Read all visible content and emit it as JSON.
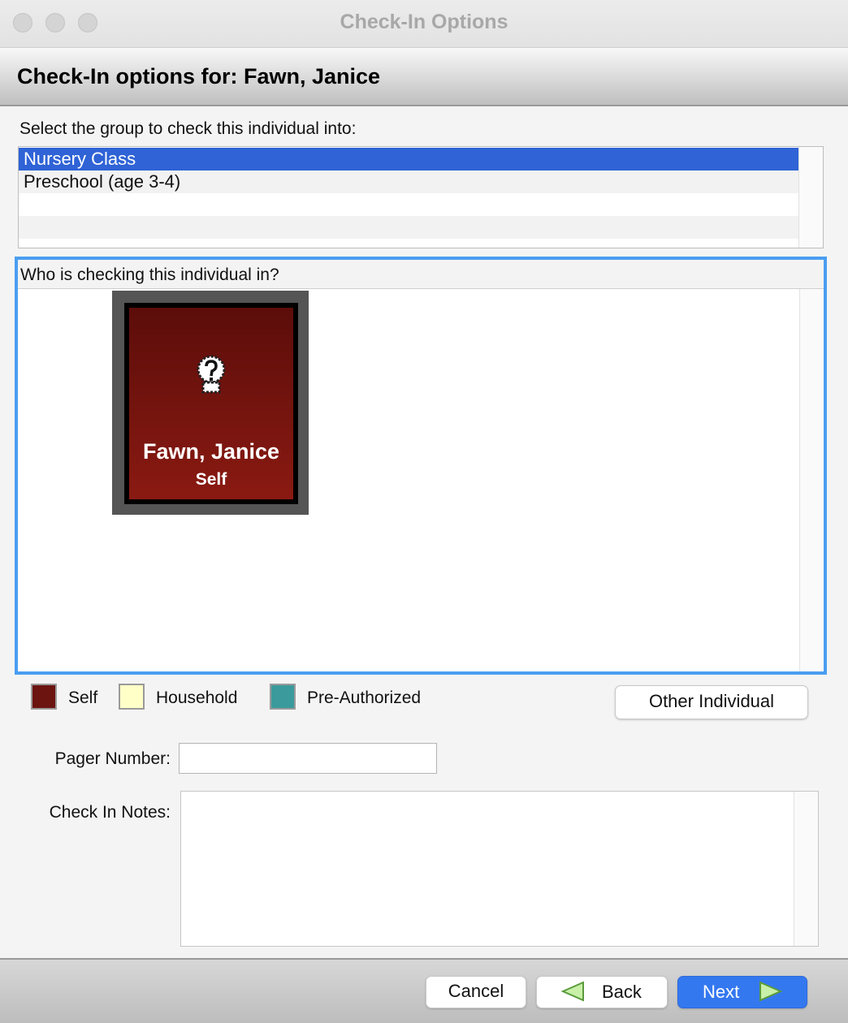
{
  "window": {
    "title": "Check-In Options"
  },
  "header": {
    "title": "Check-In options for: Fawn, Janice"
  },
  "group_select": {
    "prompt": "Select the group to check this individual into:",
    "items": [
      {
        "label": "Nursery Class",
        "selected": true
      },
      {
        "label": "Preschool (age 3-4)",
        "selected": false
      }
    ]
  },
  "checker": {
    "prompt": "Who is checking this individual in?",
    "cards": [
      {
        "name": "Fawn, Janice",
        "relation": "Self",
        "icon": "unknown-person-icon"
      }
    ]
  },
  "legend": [
    {
      "label": "Self",
      "color": "#6b1410"
    },
    {
      "label": "Household",
      "color": "#ffffc8"
    },
    {
      "label": "Pre-Authorized",
      "color": "#3a9a9c"
    }
  ],
  "other_individual_label": "Other Individual",
  "pager": {
    "label": "Pager Number:",
    "value": ""
  },
  "notes": {
    "label": "Check In Notes:",
    "value": ""
  },
  "footer": {
    "cancel_label": "Cancel",
    "back_label": "Back",
    "next_label": "Next"
  },
  "colors": {
    "accent": "#3478f0",
    "selection": "#2f63d6",
    "focus_ring": "#4a9ef0"
  }
}
